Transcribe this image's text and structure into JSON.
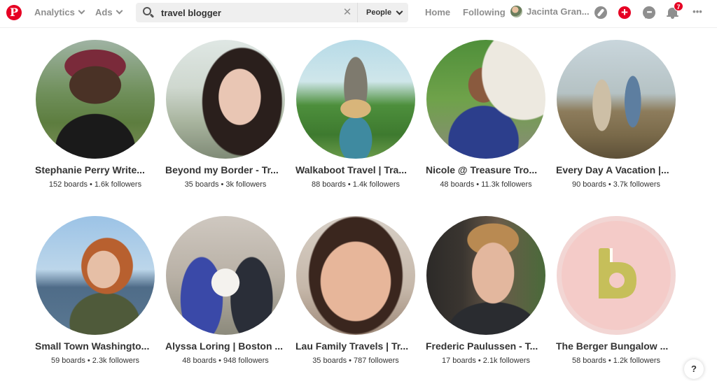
{
  "header": {
    "logo_letter": "P",
    "analytics_label": "Analytics",
    "ads_label": "Ads",
    "search_value": "travel blogger",
    "clear_glyph": "✕",
    "scope_label": "People",
    "home_label": "Home",
    "following_label": "Following",
    "profile_name": "Jacinta Gran...",
    "create_glyph": "+",
    "notifications_count": "7",
    "more_glyph": "•••",
    "icons": [
      "search-icon",
      "close-icon",
      "chevron-down-icon",
      "compass-icon",
      "plus-icon",
      "chat-icon",
      "bell-icon",
      "more-icon"
    ],
    "colors": {
      "brand": "#e60023",
      "nav_gray": "#8e8e8e",
      "search_bg": "#efefef"
    }
  },
  "results": [
    {
      "name": "Stephanie Perry Write...",
      "boards": "152 boards",
      "followers": "1.6k followers"
    },
    {
      "name": "Beyond my Border - Tr...",
      "boards": "35 boards",
      "followers": "3k followers"
    },
    {
      "name": "Walkaboot Travel | Tra...",
      "boards": "88 boards",
      "followers": "1.4k followers"
    },
    {
      "name": "Nicole @ Treasure Tro...",
      "boards": "48 boards",
      "followers": "11.3k followers"
    },
    {
      "name": "Every Day A Vacation |...",
      "boards": "90 boards",
      "followers": "3.7k followers"
    },
    {
      "name": "Small Town Washingto...",
      "boards": "59 boards",
      "followers": "2.3k followers"
    },
    {
      "name": "Alyssa Loring | Boston ...",
      "boards": "48 boards",
      "followers": "948 followers"
    },
    {
      "name": "Lau Family Travels | Tr...",
      "boards": "35 boards",
      "followers": "787 followers"
    },
    {
      "name": "Frederic Paulussen - T...",
      "boards": "17 boards",
      "followers": "2.1k followers"
    },
    {
      "name": "The Berger Bungalow ...",
      "boards": "58 boards",
      "followers": "1.2k followers"
    }
  ],
  "stats_separator": "•",
  "help_label": "?"
}
